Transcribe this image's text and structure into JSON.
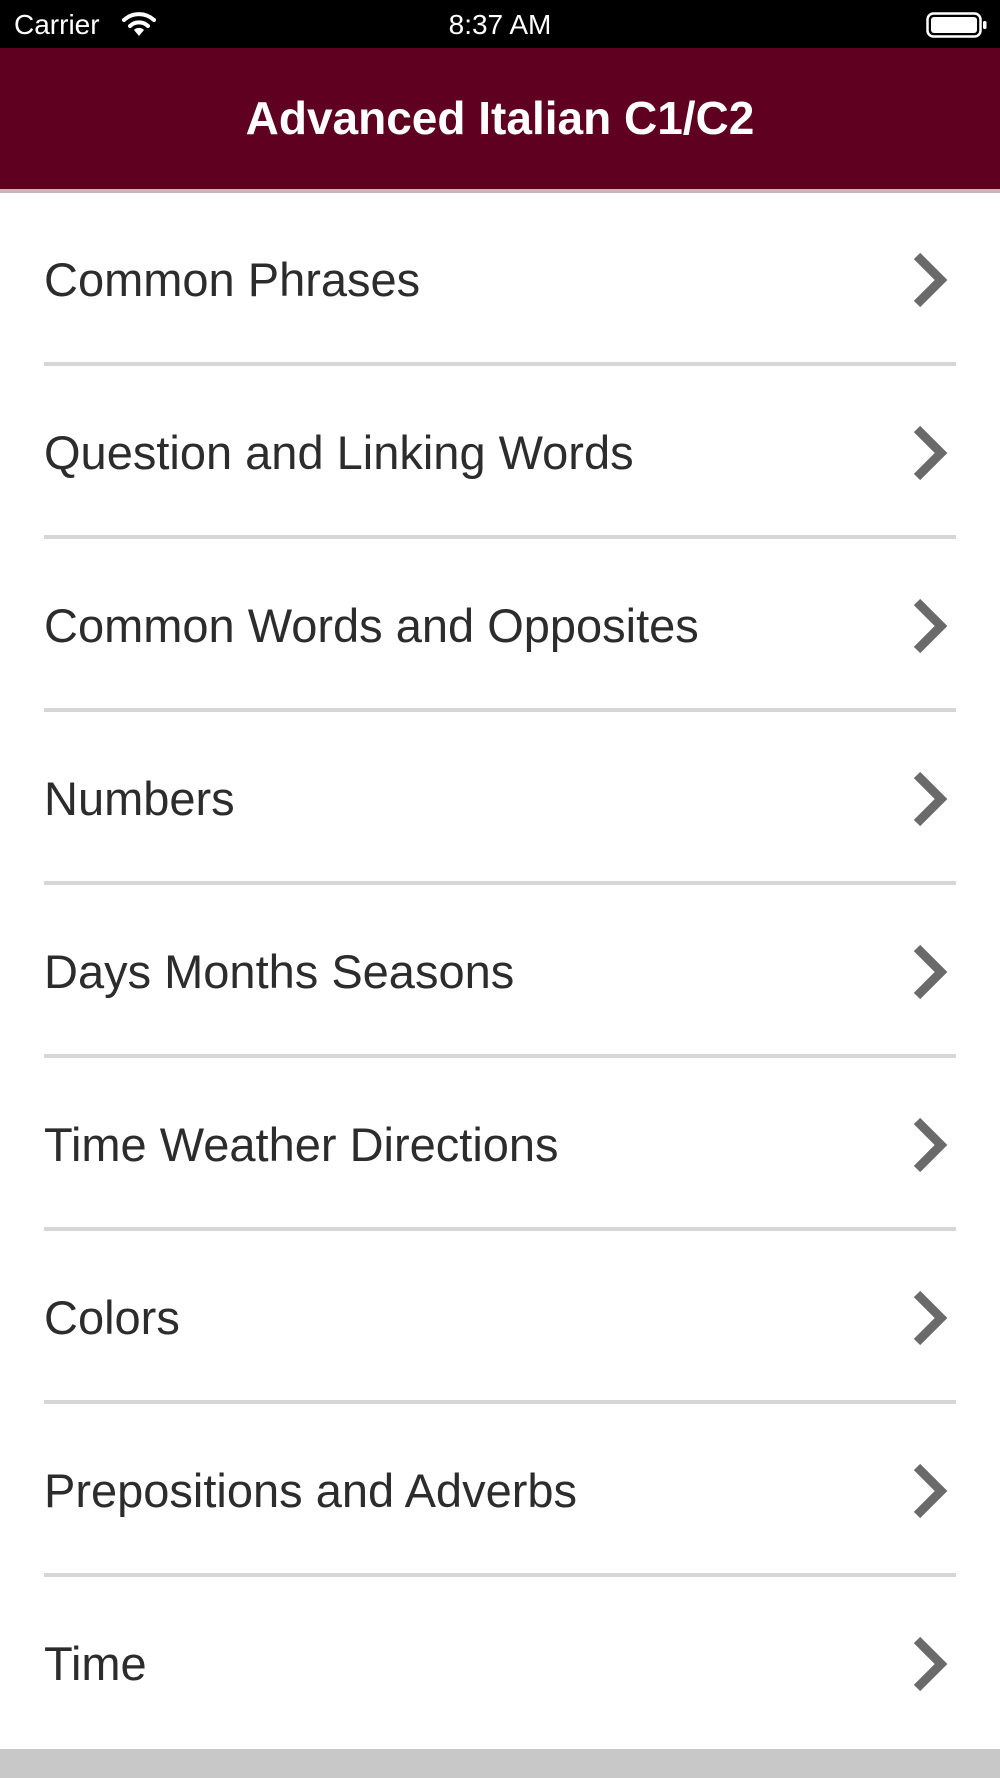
{
  "status_bar": {
    "carrier": "Carrier",
    "time": "8:37 AM",
    "icons": [
      "wifi-icon",
      "battery-icon"
    ]
  },
  "nav_bar": {
    "title": "Advanced Italian C1/C2",
    "background_color": "#5f0021"
  },
  "menu": {
    "chevron_icon": "chevron-right-icon",
    "items": [
      {
        "label": "Common Phrases"
      },
      {
        "label": "Question and Linking Words"
      },
      {
        "label": "Common Words and Opposites"
      },
      {
        "label": "Numbers"
      },
      {
        "label": "Days Months Seasons"
      },
      {
        "label": "Time Weather Directions"
      },
      {
        "label": "Colors"
      },
      {
        "label": "Prepositions and Adverbs"
      },
      {
        "label": "Time"
      }
    ]
  },
  "colors": {
    "status_bar": "#000000",
    "nav_bar": "#5f0021",
    "text": "#2c2c2c",
    "chevron": "#6a6a6a",
    "separator": "#d6d6d6"
  }
}
